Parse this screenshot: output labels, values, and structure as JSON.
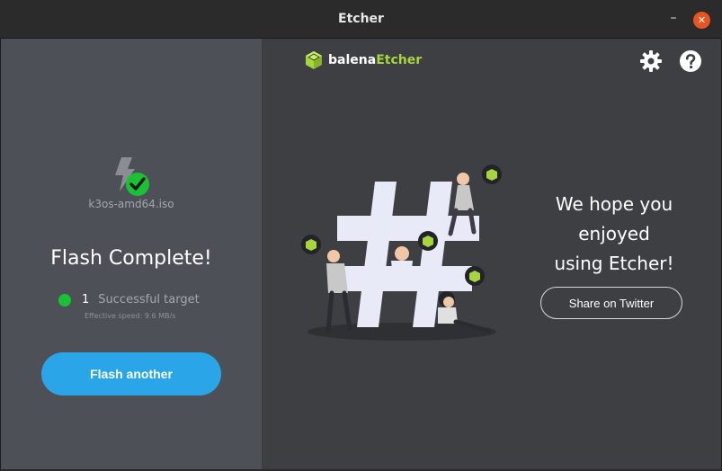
{
  "window": {
    "title": "Etcher",
    "minimize_label": "–",
    "close_label": "✕"
  },
  "left_panel": {
    "image_name": "k3os-amd64.iso",
    "status_title": "Flash Complete!",
    "target_count": "1",
    "target_label": "Successful target",
    "speed": "Effective speed: 9.6 MB/s",
    "flash_another_label": "Flash another"
  },
  "header": {
    "brand_first": "balena",
    "brand_second": "Etcher",
    "settings_icon": "gear-icon",
    "help_icon": "help-icon"
  },
  "main": {
    "thanks_line1": "We hope you",
    "thanks_line2": "enjoyed",
    "thanks_line3": "using Etcher!",
    "share_label": "Share on Twitter"
  },
  "colors": {
    "accent_blue": "#2aa6e8",
    "success_green": "#1ac135",
    "brand_green": "#a7d53e",
    "close_orange": "#e95420"
  }
}
